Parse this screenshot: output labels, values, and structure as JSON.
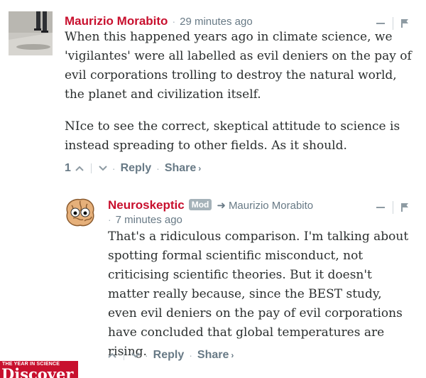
{
  "comments": [
    {
      "author": "Maurizio Morabito",
      "time": "29 minutes ago",
      "paragraphs": [
        "When this happened years ago in climate science, we 'vigilantes' were all labelled as evil deniers on the pay of evil corporations trolling to destroy the natural world, the planet and civilization itself.",
        "NIce to see the correct, skeptical attitude to science is instead spreading to other fields. As it should."
      ],
      "votes": "1",
      "reply_label": "Reply",
      "share_label": "Share"
    },
    {
      "author": "Neuroskeptic",
      "badge": "Mod",
      "reply_to": "Maurizio Morabito",
      "time": "7 minutes ago",
      "paragraphs": [
        "That's a ridiculous comparison. I'm talking about spotting formal scientific misconduct, not criticising scientific theories. But it doesn't matter really because, since the BEST study, even evil deniers on the pay of evil corporations have concluded that global temperatures are rising."
      ],
      "reply_label": "Reply",
      "share_label": "Share"
    }
  ],
  "logo": {
    "small_text": "THE YEAR IN SCIENCE",
    "big_text": "Discover"
  },
  "colors": {
    "author": "#c8102e",
    "meta": "#687a86",
    "badge": "#a5b2b9"
  },
  "icons": {
    "upvote": "chevron-up-icon",
    "downvote": "chevron-down-icon",
    "flag": "flag-icon",
    "collapse": "minus-icon",
    "reply_arrow": "arrow-right-icon"
  }
}
